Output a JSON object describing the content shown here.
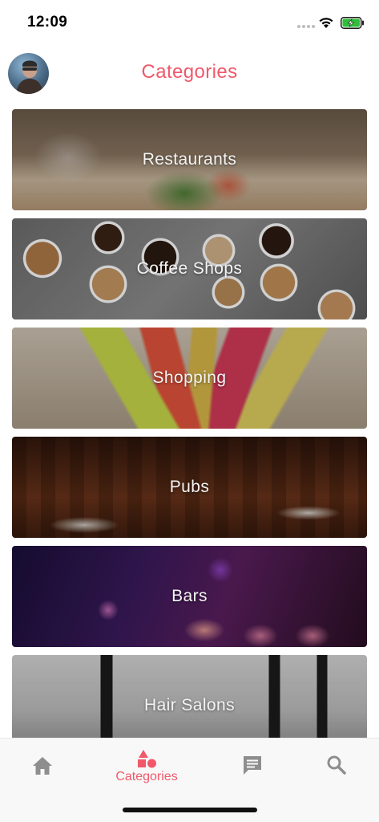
{
  "status_bar": {
    "time": "12:09",
    "battery_state": "charging",
    "battery_color": "#2fbf3a"
  },
  "header": {
    "title": "Categories",
    "accent_color": "#f0596b"
  },
  "categories": [
    {
      "label": "Restaurants"
    },
    {
      "label": "Coffee Shops"
    },
    {
      "label": "Shopping"
    },
    {
      "label": "Pubs"
    },
    {
      "label": "Bars"
    },
    {
      "label": "Hair Salons"
    }
  ],
  "tab_bar": {
    "tabs": [
      {
        "id": "home",
        "icon": "home-icon",
        "label": "",
        "active": false
      },
      {
        "id": "categories",
        "icon": "shapes-icon",
        "label": "Categories",
        "active": true
      },
      {
        "id": "messages",
        "icon": "message-icon",
        "label": "",
        "active": false
      },
      {
        "id": "search",
        "icon": "search-icon",
        "label": "",
        "active": false
      }
    ],
    "active_color": "#f0596b",
    "inactive_color": "#8e8e8e"
  }
}
